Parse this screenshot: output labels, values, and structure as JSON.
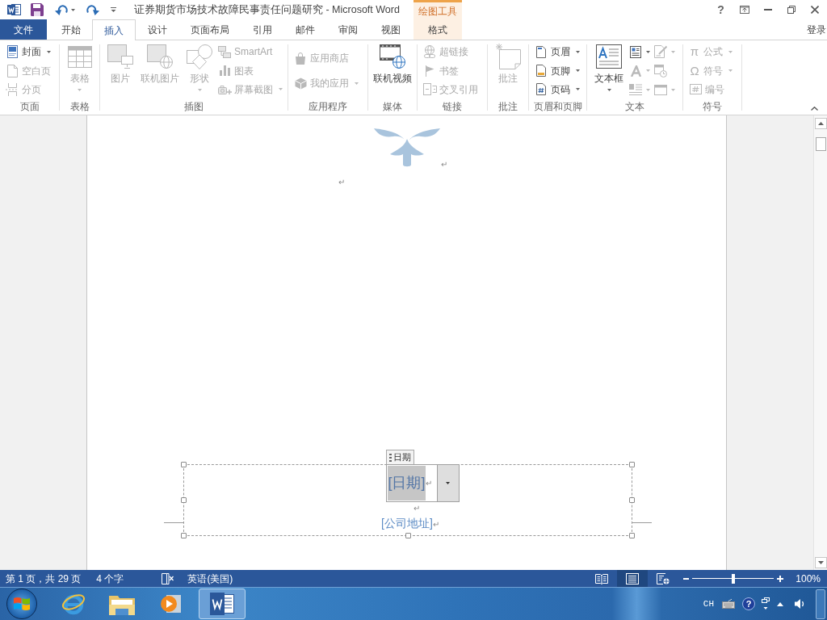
{
  "title_bar": {
    "title": "证券期货市场技术故障民事责任问题研究 - Microsoft Word",
    "help": "?"
  },
  "contextual_tabs": {
    "group": "绘图工具",
    "tabs": [
      {
        "label": "格式",
        "selected": false
      }
    ]
  },
  "tabs": [
    {
      "label": "文件",
      "kind": "file",
      "selected": false
    },
    {
      "label": "开始",
      "kind": "tab",
      "selected": false
    },
    {
      "label": "插入",
      "kind": "tab",
      "selected": true
    },
    {
      "label": "设计",
      "kind": "tab",
      "selected": false
    },
    {
      "label": "页面布局",
      "kind": "tab",
      "selected": false
    },
    {
      "label": "引用",
      "kind": "tab",
      "selected": false
    },
    {
      "label": "邮件",
      "kind": "tab",
      "selected": false
    },
    {
      "label": "审阅",
      "kind": "tab",
      "selected": false
    },
    {
      "label": "视图",
      "kind": "tab",
      "selected": false
    }
  ],
  "account": "登录",
  "ribbon": {
    "groups": [
      {
        "label": "页面",
        "items": [
          {
            "kind": "small",
            "label": "封面",
            "disabled": false,
            "dropdown": true
          },
          {
            "kind": "small",
            "label": "空白页",
            "disabled": true,
            "dropdown": false
          },
          {
            "kind": "small",
            "label": "分页",
            "disabled": true,
            "dropdown": false
          }
        ]
      },
      {
        "label": "表格",
        "items": [
          {
            "kind": "large",
            "label": "表格",
            "disabled": true,
            "dropdown": true
          }
        ]
      },
      {
        "label": "插图",
        "items": [
          {
            "kind": "large",
            "label": "图片",
            "disabled": true,
            "dropdown": false
          },
          {
            "kind": "large",
            "label": "联机图片",
            "disabled": true,
            "dropdown": false
          },
          {
            "kind": "large",
            "label": "形状",
            "disabled": true,
            "dropdown": true
          },
          {
            "kind": "small",
            "label": "SmartArt",
            "disabled": true,
            "dropdown": false
          },
          {
            "kind": "small",
            "label": "图表",
            "disabled": true,
            "dropdown": false
          },
          {
            "kind": "small",
            "label": "屏幕截图",
            "disabled": true,
            "dropdown": true
          }
        ]
      },
      {
        "label": "应用程序",
        "items": [
          {
            "kind": "small",
            "label": "应用商店",
            "disabled": true,
            "dropdown": false
          },
          {
            "kind": "small",
            "label": "我的应用",
            "disabled": true,
            "dropdown": true
          }
        ]
      },
      {
        "label": "媒体",
        "items": [
          {
            "kind": "large",
            "label": "联机视频",
            "disabled": false,
            "dropdown": false
          }
        ]
      },
      {
        "label": "链接",
        "items": [
          {
            "kind": "small",
            "label": "超链接",
            "disabled": true,
            "dropdown": false
          },
          {
            "kind": "small",
            "label": "书签",
            "disabled": true,
            "dropdown": false
          },
          {
            "kind": "small",
            "label": "交叉引用",
            "disabled": true,
            "dropdown": false
          }
        ]
      },
      {
        "label": "批注",
        "items": [
          {
            "kind": "large",
            "label": "批注",
            "disabled": true,
            "dropdown": false
          }
        ]
      },
      {
        "label": "页眉和页脚",
        "items": [
          {
            "kind": "small",
            "label": "页眉",
            "disabled": false,
            "dropdown": true
          },
          {
            "kind": "small",
            "label": "页脚",
            "disabled": false,
            "dropdown": true
          },
          {
            "kind": "small",
            "label": "页码",
            "disabled": false,
            "dropdown": true
          }
        ]
      },
      {
        "label": "文本",
        "items": [
          {
            "kind": "large",
            "label": "文本框",
            "disabled": false,
            "dropdown": true
          },
          {
            "kind": "icon",
            "disabled": false,
            "dropdown": true
          },
          {
            "kind": "icon",
            "disabled": true,
            "dropdown": true
          },
          {
            "kind": "icon",
            "disabled": true,
            "dropdown": true
          },
          {
            "kind": "icon",
            "disabled": true,
            "dropdown": true
          },
          {
            "kind": "icon",
            "disabled": true,
            "dropdown": false
          },
          {
            "kind": "icon",
            "disabled": true,
            "dropdown": true
          }
        ]
      },
      {
        "label": "符号",
        "items": [
          {
            "kind": "small",
            "label": "公式",
            "glyph": "π",
            "disabled": true,
            "dropdown": true
          },
          {
            "kind": "small",
            "label": "符号",
            "glyph": "Ω",
            "disabled": true,
            "dropdown": true
          },
          {
            "kind": "small",
            "label": "编号",
            "disabled": true,
            "dropdown": false
          }
        ]
      }
    ]
  },
  "document": {
    "paragraph_marks": [
      "↵",
      "↵"
    ],
    "footer": {
      "date_control": {
        "tag": "日期",
        "text": "[日期]",
        "mark": "↵",
        "selected": true
      },
      "blank_line_mark": "↵",
      "address": "[公司地址]",
      "address_mark": "↵"
    }
  },
  "status_bar": {
    "page": "第 1 页，共 29 页",
    "words": "4 个字",
    "language": "英语(美国)",
    "views": [
      {
        "selected": false
      },
      {
        "selected": true
      },
      {
        "selected": false
      }
    ],
    "zoom": {
      "level": 0.5,
      "reading": "100%"
    }
  },
  "taskbar": {
    "apps": [
      {
        "selected": false
      },
      {
        "selected": false
      },
      {
        "selected": false
      },
      {
        "selected": true
      }
    ],
    "tray": {
      "input_language": "CH",
      "help": "?"
    }
  }
}
